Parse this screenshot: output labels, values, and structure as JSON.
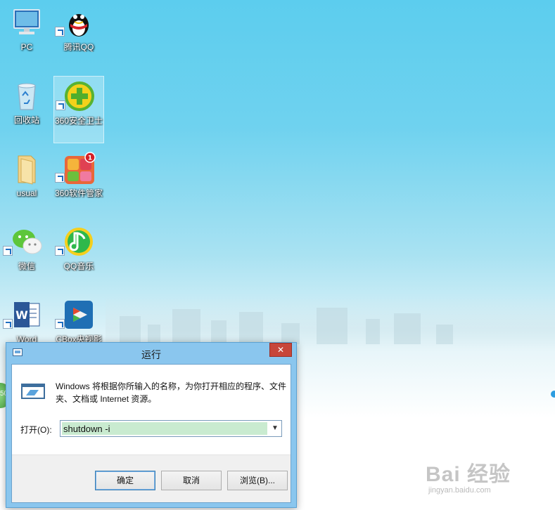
{
  "desktop": {
    "icons": [
      {
        "label": "PC"
      },
      {
        "label": "腾讯QQ"
      },
      {
        "label": "回收站"
      },
      {
        "label": "360安全卫士"
      },
      {
        "label": "usual"
      },
      {
        "label": "360软件管家"
      },
      {
        "label": "微信"
      },
      {
        "label": "QQ音乐"
      },
      {
        "label": "Word"
      },
      {
        "label": "CBox央视影"
      }
    ],
    "badge_count": "1",
    "circle_text": "50"
  },
  "run_dialog": {
    "title": "运行",
    "close_label": "✕",
    "description": "Windows 将根据你所输入的名称，为你打开相应的程序、文件夹、文档或 Internet 资源。",
    "open_label": "打开(O):",
    "input_value": "shutdown -i",
    "ok_label": "确定",
    "cancel_label": "取消",
    "browse_label": "浏览(B)..."
  },
  "watermark": {
    "main": "Bai 经验",
    "sub": "jingyan.baidu.com"
  },
  "colors": {
    "dialog_frame": "#8ac6ee",
    "close_button": "#c7463a",
    "input_selection": "#c9ebd0"
  }
}
